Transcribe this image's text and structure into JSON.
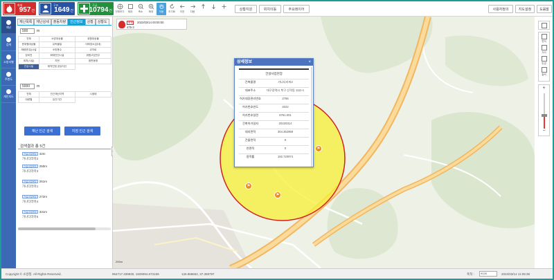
{
  "header": {
    "stats": [
      {
        "label": "화재",
        "value": "957",
        "unit": "건"
      },
      {
        "label": "구조",
        "value": "1649",
        "unit": "건"
      },
      {
        "label": "구급",
        "value": "10794",
        "unit": "건"
      }
    ],
    "tools": [
      "전체보기",
      "제대",
      "축소",
      "확대",
      "이동",
      "초기화",
      "이전",
      "다음",
      "",
      "",
      ""
    ],
    "center_buttons": [
      "상황지원",
      "위치이동",
      "주요레이어"
    ],
    "right_buttons": [
      "사용자정의",
      "지도설정",
      "도움말"
    ]
  },
  "rail": {
    "items": [
      "재난",
      "검색",
      "소방서별",
      "주변도",
      "개인지도"
    ]
  },
  "panel": {
    "tabs": [
      "재난목록",
      "재난상세",
      "출동차량",
      "인근정보",
      "상황",
      "상황도"
    ],
    "radius1": {
      "value": "500",
      "unit": "m"
    },
    "grid1": [
      "전체",
      "소방대상물",
      "위험대상물",
      "준위험대상물",
      "유독물질",
      "대피장소(임대)",
      "재량(빈집)시설",
      "소방용수",
      "교차로",
      "장비전",
      "화재안전시설",
      "위험고압전주",
      "위치(시설)",
      "지번",
      "읍면동명",
      "관심시설",
      "제작인정 공유자산"
    ],
    "radius2": {
      "value": "5000",
      "unit": "m"
    },
    "grid2": [
      "전체",
      "인근재난지역",
      "시생태",
      "대량별",
      "유관기관"
    ],
    "buttons": [
      "재난 인근 검색",
      "지점 인근 검색"
    ],
    "results_title": "검색결과 총 5건",
    "results": [
      {
        "badge": "건설사업현장",
        "dist": "42m",
        "name": "가나다라마2"
      },
      {
        "badge": "건설사업현장",
        "dist": "250m",
        "name": "가나다라마3"
      },
      {
        "badge": "건설사업현장",
        "dist": "261m",
        "name": "가나다라마1"
      },
      {
        "badge": "건설사업현장",
        "dist": "272m",
        "name": "가나다라마4"
      },
      {
        "badge": "건설사업현장",
        "dist": "331m",
        "name": "가나다라마5"
      }
    ]
  },
  "map": {
    "alert": {
      "type": "화재",
      "time": "2022/03/14 00:00:00",
      "address": "476-3"
    },
    "popup": {
      "title": "상세정보",
      "caption": "건설사업현장",
      "rows": [
        {
          "k": "건축물명",
          "v": "가나다라마2"
        },
        {
          "k": "대표주소",
          "v": "대구광역시 북구 산격동 1111-1"
        },
        {
          "k": "허가대장관리번호",
          "v": "2766"
        },
        {
          "k": "허가번호연도",
          "v": "2022"
        },
        {
          "k": "허가번호일련",
          "v": "6761.001"
        },
        {
          "k": "건축허가일자",
          "v": "20220314"
        },
        {
          "k": "대지면적",
          "v": "304.352959"
        },
        {
          "k": "건물면적",
          "v": "0"
        },
        {
          "k": "연면적",
          "v": "0"
        },
        {
          "k": "용적률",
          "v": "192.720974"
        }
      ]
    },
    "side_tools": [
      "레이어",
      "면적",
      "거리",
      "반경",
      "출력"
    ],
    "scale": "200m"
  },
  "footer": {
    "copyright": "Copyright © 소방청. All Rights Reserved.",
    "coords1": "954717.339930, 1929094.673159",
    "coords2": "126.968652, 37.359797",
    "scale_label": "축척 :",
    "scale_value": "9028",
    "datetime": "2022/03/14 11:09:38"
  }
}
